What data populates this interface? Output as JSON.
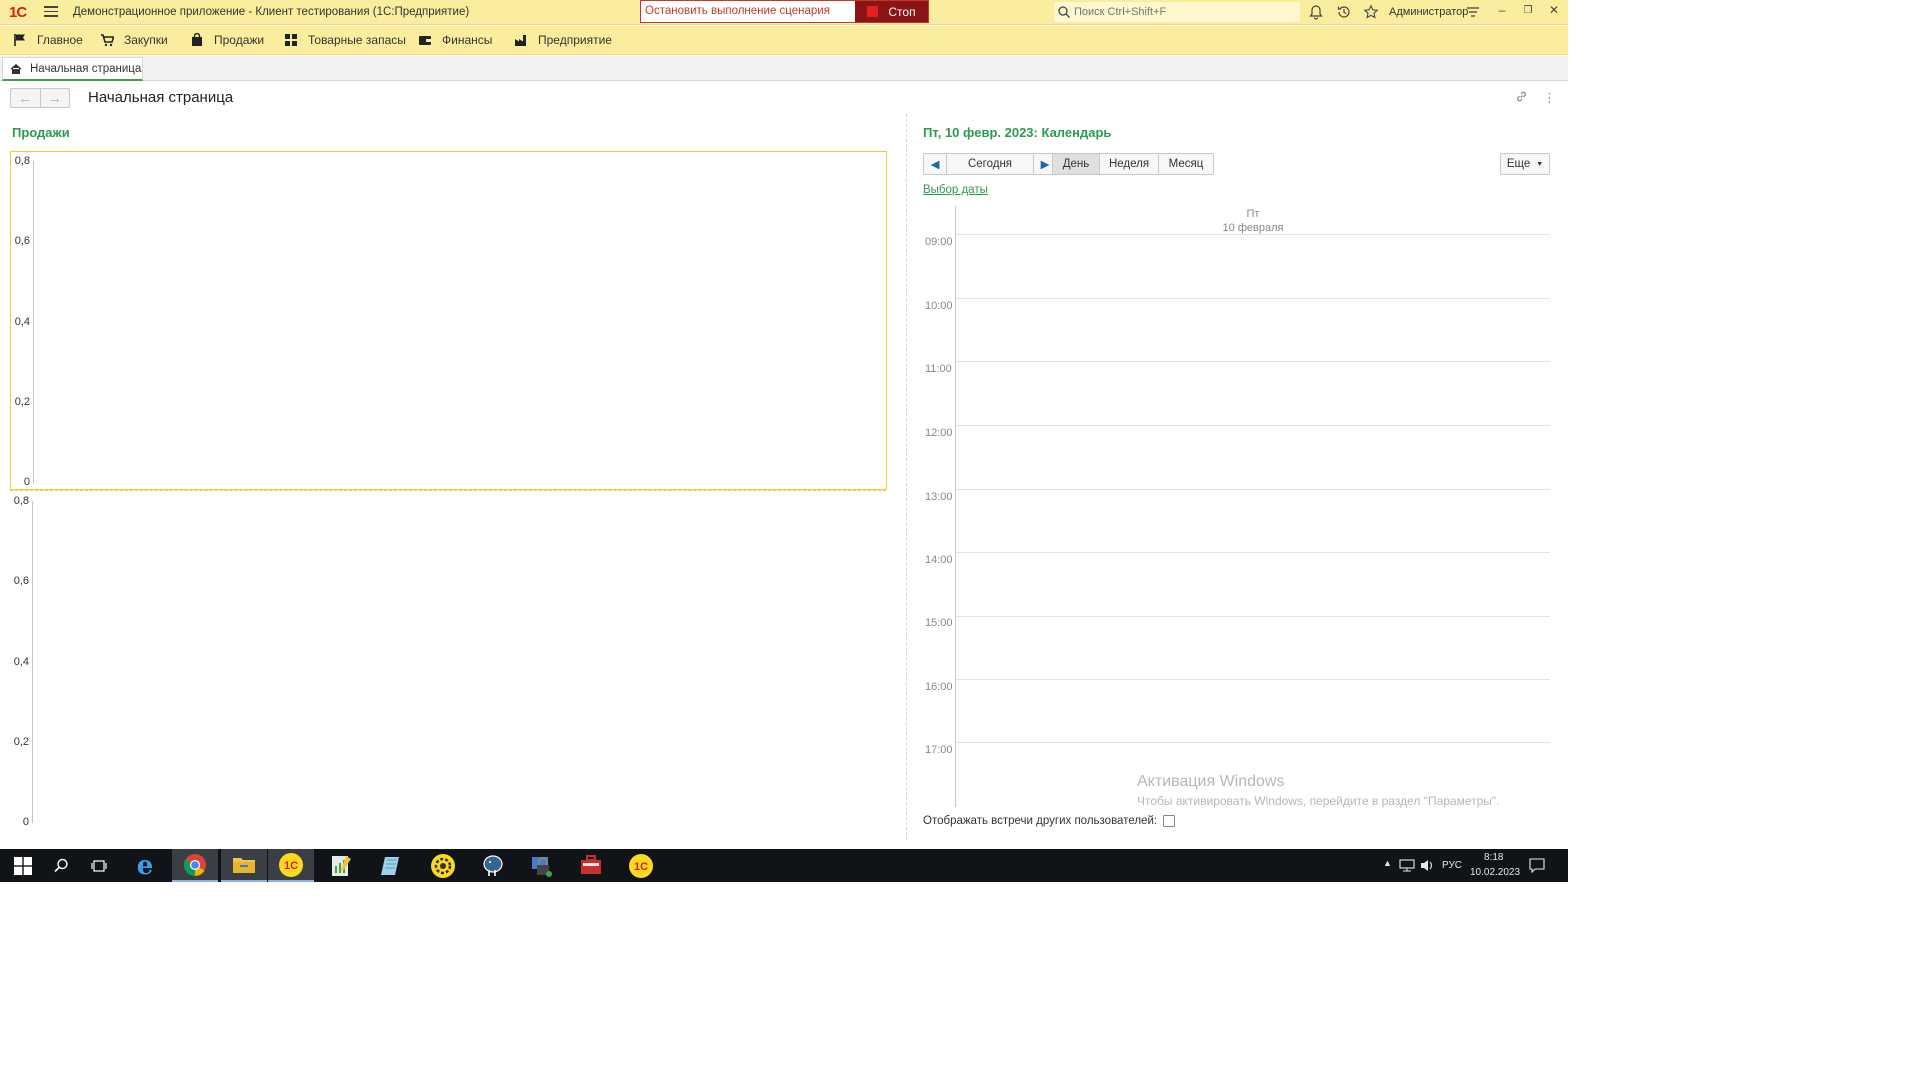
{
  "titlebar": {
    "logo": "1С",
    "title": "Демонстрационное приложение  - Клиент тестирования (1С:Предприятие)",
    "stop_message": "Остановить выполнение сценария",
    "stop_button": "Стоп",
    "search_placeholder": "Поиск Ctrl+Shift+F",
    "user": "Администратор"
  },
  "sections": [
    {
      "label": "Главное",
      "icon": "flag-icon"
    },
    {
      "label": "Закупки",
      "icon": "cart-icon"
    },
    {
      "label": "Продажи",
      "icon": "bag-icon"
    },
    {
      "label": "Товарные запасы",
      "icon": "grid-icon"
    },
    {
      "label": "Финансы",
      "icon": "wallet-icon"
    },
    {
      "label": "Предприятие",
      "icon": "factory-icon"
    }
  ],
  "tab": {
    "label": "Начальная страница"
  },
  "page": {
    "title": "Начальная страница"
  },
  "sales": {
    "title": "Продажи",
    "ticks": [
      "0,8",
      "0,6",
      "0,4",
      "0,2",
      "0"
    ]
  },
  "calendar": {
    "title": "Пт, 10 февр. 2023: Календарь",
    "today": "Сегодня",
    "views": [
      "День",
      "Неделя",
      "Месяц"
    ],
    "active_view": "День",
    "more": "Еще",
    "date_select": "Выбор даты",
    "day_short": "Пт",
    "day_date": "10 февраля",
    "hours": [
      "09:00",
      "10:00",
      "11:00",
      "12:00",
      "13:00",
      "14:00",
      "15:00",
      "16:00",
      "17:00"
    ],
    "show_others": "Отображать встречи других пользователей:"
  },
  "watermark": {
    "line1": "Активация Windows",
    "line2": "Чтобы активировать Windows, перейдите в раздел \"Параметры\"."
  },
  "taskbar": {
    "lang": "РУС",
    "time": "8:18",
    "date": "10.02.2023"
  },
  "colors": {
    "header_bg": "#fbed9e",
    "accent_green": "#2e9a4f",
    "stop_red": "#8b1515"
  }
}
